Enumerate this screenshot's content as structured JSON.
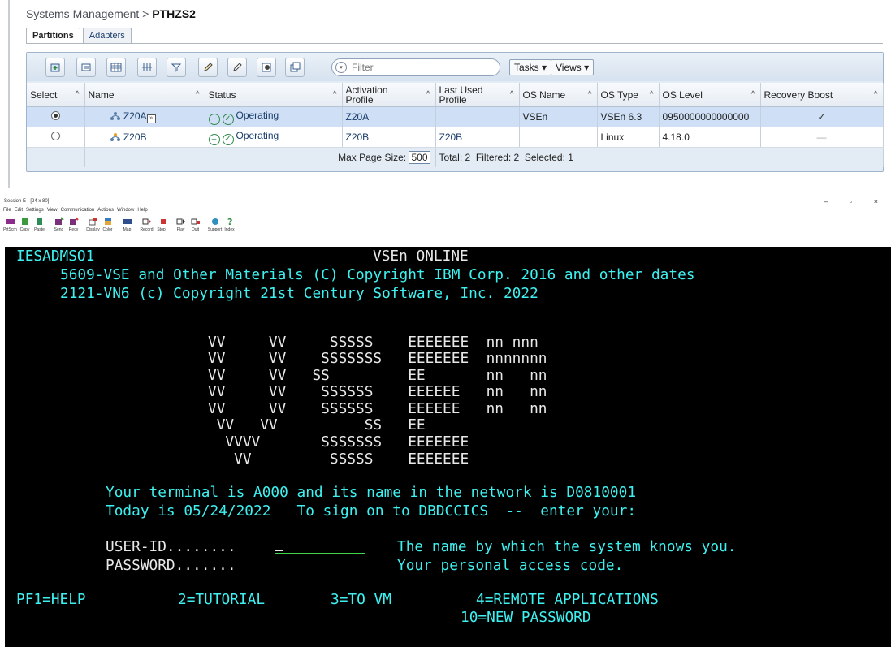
{
  "breadcrumb": {
    "parent": "Systems Management",
    "separator": " > ",
    "current": "PTHZS2"
  },
  "tabs": [
    {
      "label": "Partitions"
    },
    {
      "label": "Adapters"
    }
  ],
  "toolbar": {
    "filter_placeholder": "Filter",
    "tasks_label": "Tasks ▾",
    "views_label": "Views ▾",
    "buttons": [
      "new-partition",
      "details",
      "table-config",
      "columns",
      "filter-rows",
      "edit",
      "edit-2",
      "start",
      "copy"
    ]
  },
  "columns": [
    "Select",
    "Name",
    "Status",
    "Activation Profile",
    "Last Used Profile",
    "OS Name",
    "OS Type",
    "OS Level",
    "Recovery Boost"
  ],
  "rows": [
    {
      "selected": true,
      "name": "Z20A",
      "status": "Operating",
      "activation_profile": "Z20A",
      "last_used_profile": "",
      "os_name": "VSEn",
      "os_type": "VSEn 6.3",
      "os_level": "0950000000000000",
      "recovery_boost": "✓"
    },
    {
      "selected": false,
      "name": "Z20B",
      "status": "Operating",
      "activation_profile": "Z20B",
      "last_used_profile": "Z20B",
      "os_name": "",
      "os_type": "Linux",
      "os_level": "4.18.0",
      "recovery_boost": "—"
    }
  ],
  "footer": {
    "page_size_label": "Max Page Size:",
    "page_size": "500",
    "summary": "Total: 2  Filtered: 2  Selected: 1"
  },
  "emulator": {
    "title": "Session E - [24 x 80]",
    "window_controls": "–  ▫  ×",
    "menu": [
      "File",
      "Edit",
      "Settings",
      "View",
      "Communication",
      "Actions",
      "Window",
      "Help"
    ],
    "tools": [
      "PrtScrn",
      "Copy",
      "Paste",
      "Send",
      "Recv",
      "Display",
      "Color",
      "Map",
      "Record",
      "Stop",
      "Play",
      "Quit",
      "Support",
      "Index"
    ]
  },
  "terminal": {
    "l1a": "IESADMSO1",
    "l1b": "VSEn ONLINE",
    "l2": "5609-VSE and Other Materials (C) Copyright IBM Corp. 2016 and other dates",
    "l3": "2121-VN6 (c) Copyright 21st Century Software, Inc. 2022",
    "art": [
      "VV     VV     SSSSS    EEEEEEE  nn nnn",
      "VV     VV    SSSSSSS   EEEEEEE  nnnnnnn",
      "VV     VV   SS         EE       nn   nn",
      "VV     VV    SSSSSS    EEEEEE   nn   nn",
      "VV     VV    SSSSSS    EEEEEE   nn   nn",
      " VV   VV          SS   EE",
      "  VVVV       SSSSSSS   EEEEEEE",
      "   VV         SSSSS    EEEEEEE"
    ],
    "msg1": "Your terminal is A000 and its name in the network is D0810001",
    "msg2": "Today is 05/24/2022   To sign on to DBDCCICS  --  enter your:",
    "user_label": "USER-ID........",
    "user_hint": "The name by which the system knows you.",
    "pass_label": "PASSWORD.......",
    "pass_hint": "Your personal access code.",
    "pf1": "PF1=HELP",
    "pf2": "2=TUTORIAL",
    "pf3": "3=TO VM",
    "pf4": "4=REMOTE APPLICATIONS",
    "pf10": "10=NEW PASSWORD"
  }
}
